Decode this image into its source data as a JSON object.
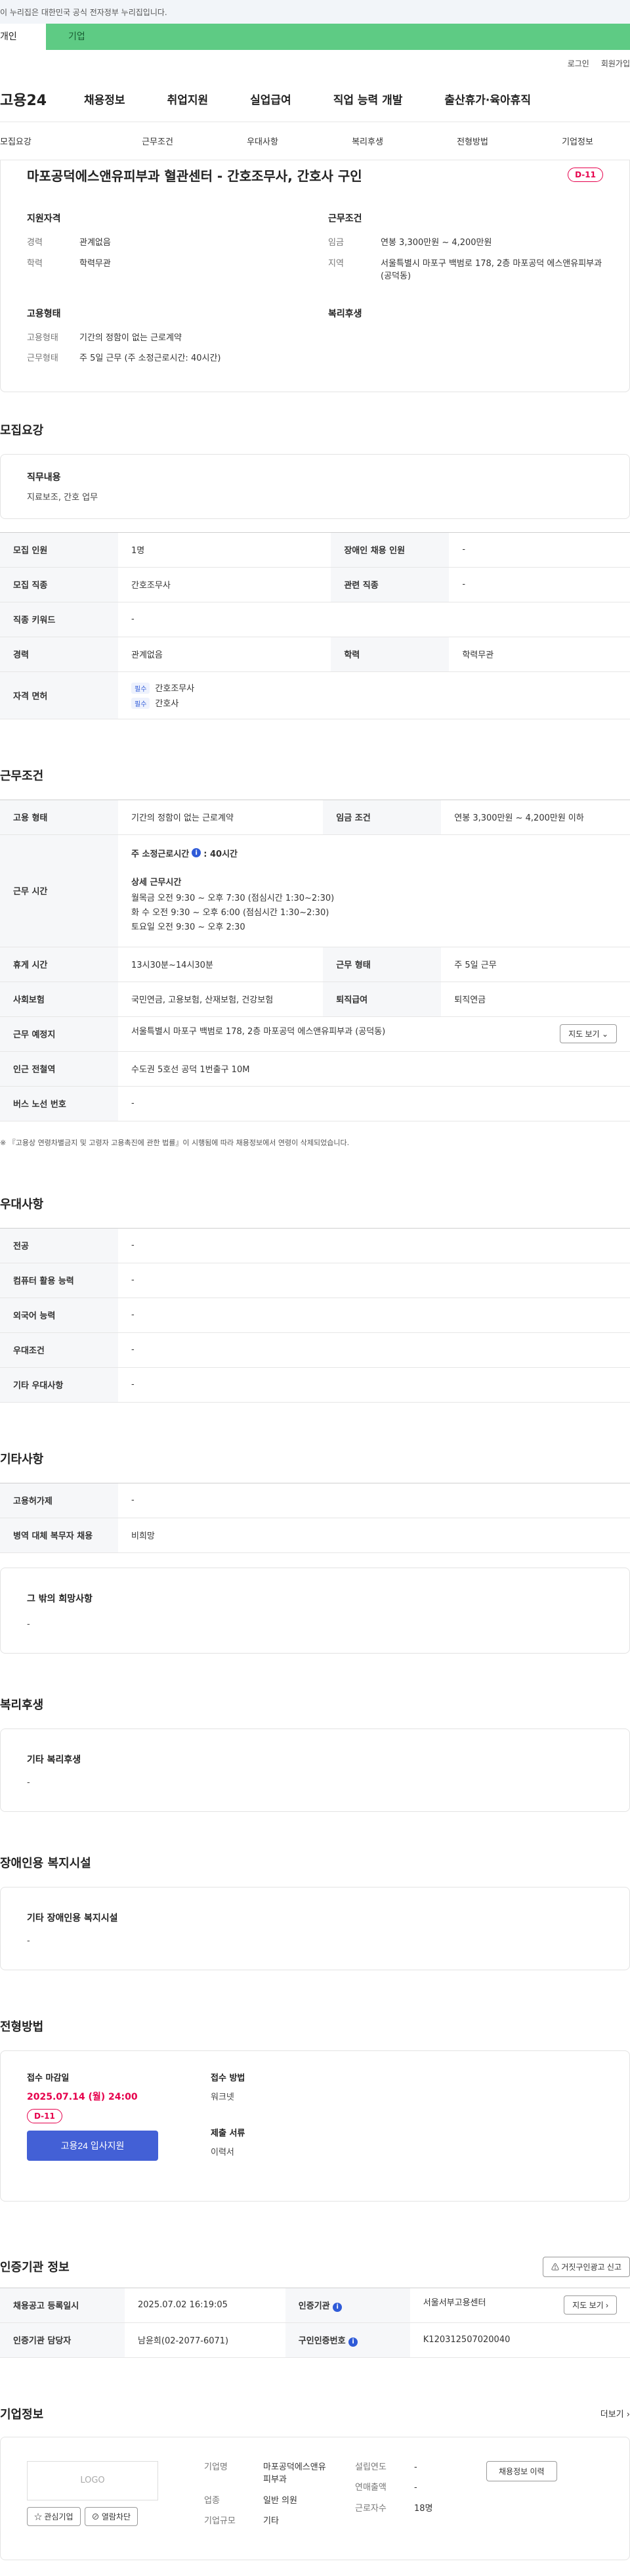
{
  "gov_banner": "이 누리집은 대한민국 공식 전자정부 누리집입니다.",
  "top_tabs": {
    "personal": "개인",
    "company": "기업"
  },
  "util": {
    "login": "로그인",
    "join": "회원가입"
  },
  "gnb": {
    "logo": "고용24",
    "menu": [
      "채용정보",
      "취업지원",
      "실업급여",
      "직업 능력 개발",
      "출산휴가·육아휴직"
    ]
  },
  "anchor_nav": [
    "모집요강",
    "근무조건",
    "우대사항",
    "복리후생",
    "전형방법",
    "기업정보"
  ],
  "summary": {
    "title": "마포공덕에스앤유피부과 혈관센터 - 간호조무사, 간호사 구인",
    "dday": "D-11",
    "qualification": {
      "title": "지원자격",
      "rows": [
        {
          "k": "경력",
          "v": "관계없음"
        },
        {
          "k": "학력",
          "v": "학력무관"
        }
      ]
    },
    "conditions": {
      "title": "근무조건",
      "rows": [
        {
          "k": "임금",
          "v": "연봉 3,300만원 ~ 4,200만원"
        },
        {
          "k": "지역",
          "v": "서울특별시 마포구 백범로 178, 2층 마포공덕 에스앤유피부과 (공덕동)"
        }
      ]
    },
    "employment": {
      "title": "고용형태",
      "rows": [
        {
          "k": "고용형태",
          "v": "기간의 정함이 없는 근로계약"
        },
        {
          "k": "근무형태",
          "v": "주 5일 근무 (주 소정근로시간: 40시간)"
        }
      ]
    },
    "welfare_title": "복리후생"
  },
  "recruit": {
    "title": "모집요강",
    "duty_title": "직무내용",
    "duty": "지료보조, 간호 업무",
    "rows": [
      {
        "k1": "모집 인원",
        "v1": "1명",
        "k2": "장애인 채용 인원",
        "v2": "-"
      },
      {
        "k1": "모집 직종",
        "v1": "간호조무사",
        "k2": "관련 직종",
        "v2": "-"
      }
    ],
    "keyword_k": "직종 키워드",
    "keyword_v": "-",
    "career_k": "경력",
    "career_v": "관계없음",
    "edu_k": "학력",
    "edu_v": "학력무관",
    "license_k": "자격 면허",
    "licenses": [
      {
        "chip": "필수",
        "name": "간호조무사"
      },
      {
        "chip": "필수",
        "name": "간호사"
      }
    ]
  },
  "work": {
    "title": "근무조건",
    "type_k": "고용 형태",
    "type_v": "기간의 정함이 없는 근로계약",
    "wage_k": "임금 조건",
    "wage_v": "연봉 3,300만원 ~ 4,200만원 이하",
    "time_k": "근무 시간",
    "weekly_label": "주 소정근로시간",
    "weekly_value": ": 40시간",
    "detail_label": "상세 근무시간",
    "detail_lines": [
      "월목금   오전 9:30 ~ 오후 7:30 (점심시간 1:30~2:30)",
      "화  수   오전 9:30 ~ 오후 6:00 (점심시간 1:30~2:30)",
      "토요일   오전 9:30 ~ 오후 2:30"
    ],
    "rest_k": "휴게 시간",
    "rest_v": "13시30분~14시30분",
    "form_k": "근무 형태",
    "form_v": "주 5일 근무",
    "insurance_k": "사회보험",
    "insurance_v": "국민연금, 고용보험, 산재보험, 건강보험",
    "severance_k": "퇴직급여",
    "severance_v": "퇴직연금",
    "place_k": "근무 예정지",
    "place_v": "서울특별시 마포구 백범로 178, 2층 마포공덕 에스앤유피부과 (공덕동)",
    "map_btn": "지도 보기",
    "subway_k": "인근 전철역",
    "subway_v": "수도권 5호선 공덕 1번출구 10M",
    "bus_k": "버스 노선 번호",
    "bus_v": "-",
    "note": "※ 『고용상 연령차별금지 및 고령자 고용촉진에 관한 법률』이 시행됨에 따라 채용정보에서 연령이 삭제되었습니다."
  },
  "pref": {
    "title": "우대사항",
    "rows": [
      {
        "k": "전공",
        "v": "-"
      },
      {
        "k": "컴퓨터 활용 능력",
        "v": "-"
      },
      {
        "k": "외국어 능력",
        "v": "-"
      },
      {
        "k": "우대조건",
        "v": "-"
      },
      {
        "k": "기타 우대사항",
        "v": "-"
      }
    ]
  },
  "etc": {
    "title": "기타사항",
    "rows": [
      {
        "k": "고용허가제",
        "v": "-"
      },
      {
        "k": "병역 대체 복무자 채용",
        "v": "비희망"
      }
    ],
    "wish_title": "그 밖의 희망사항",
    "wish_v": "-"
  },
  "welfare": {
    "title": "복리후생",
    "box_title": "기타 복리후생",
    "box_v": "-"
  },
  "disability": {
    "title": "장애인용 복지시설",
    "box_title": "기타 장애인용 복지시설",
    "box_v": "-"
  },
  "process": {
    "title": "전형방법",
    "deadline_label": "접수 마감일",
    "deadline": "2025.07.14 (월) 24:00",
    "dday": "D-11",
    "apply_btn": "고용24 입사지원",
    "method_label": "접수 방법",
    "method_v": "워크넷",
    "docs_label": "제출 서류",
    "docs_v": "이력서"
  },
  "cert": {
    "title": "인증기관 정보",
    "report_btn": "거짓구인광고 신고",
    "rows": [
      {
        "k1": "채용공고 등록일시",
        "v1": "2025.07.02 16:19:05",
        "k2": "인증기관",
        "v2": "서울서부고용센터",
        "btn": "지도 보기"
      },
      {
        "k1": "인증기관 담당자",
        "v1": "남윤희(02-2077-6071)",
        "k2": "구인인증번호",
        "v2": "K120312507020040"
      }
    ]
  },
  "company": {
    "title": "기업정보",
    "more": "더보기",
    "logo": "LOGO",
    "fav_btn": "관심기업",
    "block_btn": "열람차단",
    "left": [
      {
        "k": "기업명",
        "v": "마포공덕에스앤유피부과"
      },
      {
        "k": "업종",
        "v": "일반 의원"
      },
      {
        "k": "기업규모",
        "v": "기타"
      }
    ],
    "right": [
      {
        "k": "설립연도",
        "v": "-"
      },
      {
        "k": "연매출액",
        "v": "-"
      },
      {
        "k": "근로자수",
        "v": "18명"
      }
    ],
    "history_btn": "채용정보 이력"
  }
}
